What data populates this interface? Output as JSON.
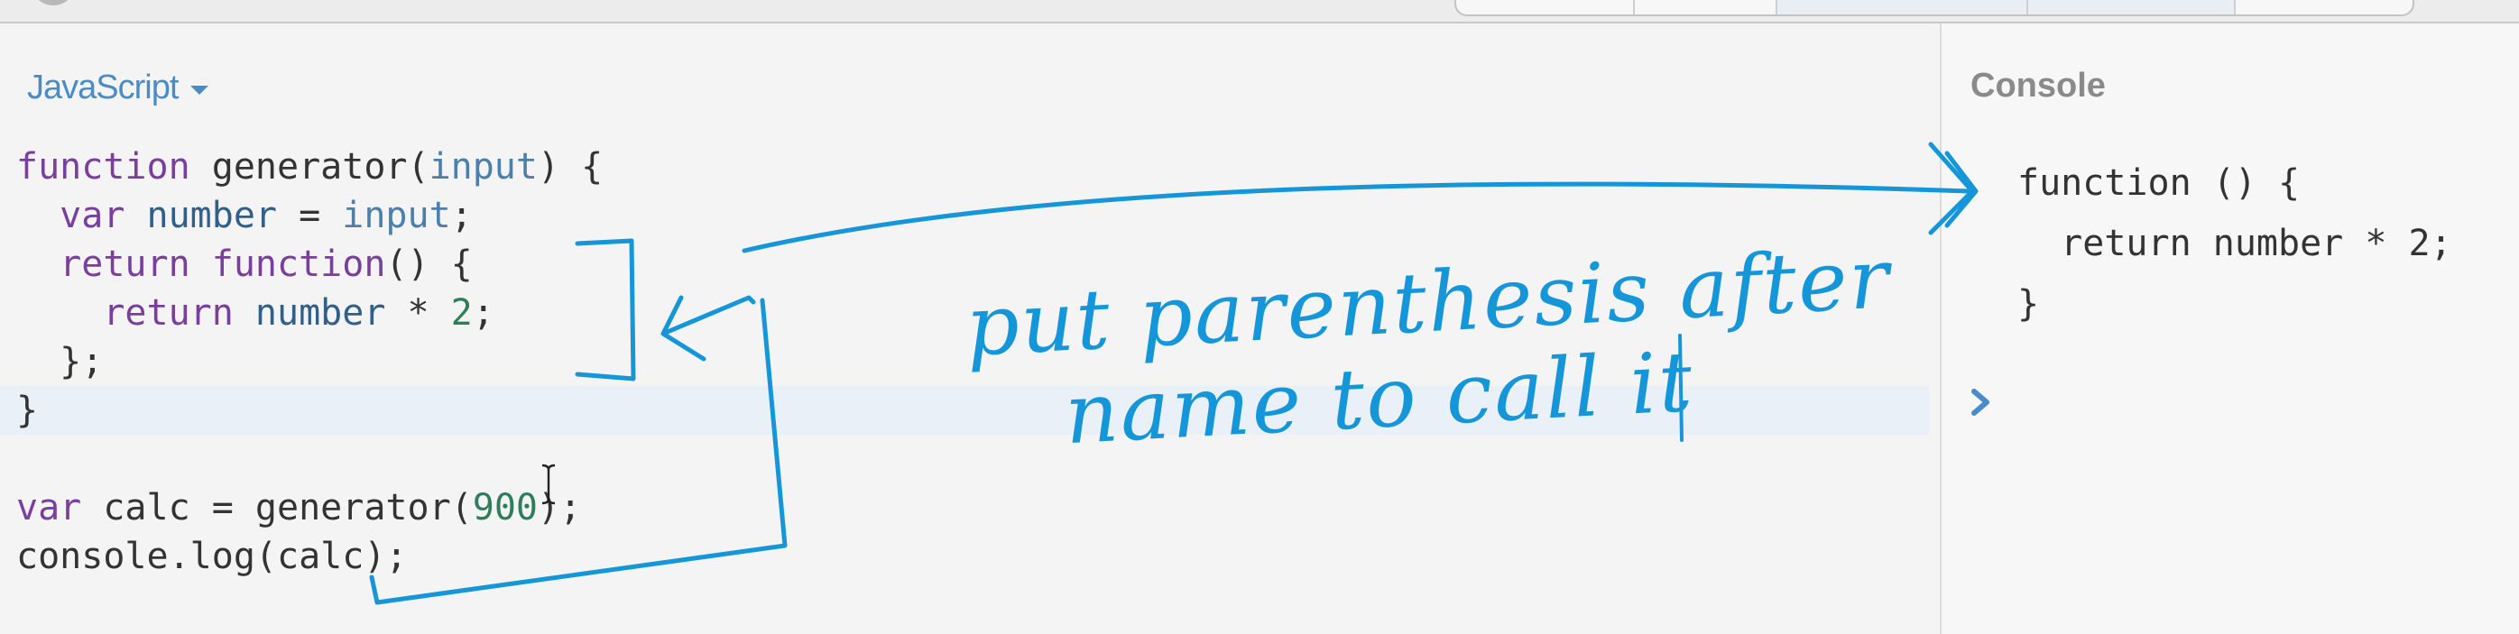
{
  "editor": {
    "language": "JavaScript",
    "code_lines": [
      [
        {
          "t": "function",
          "c": "kw"
        },
        {
          "t": " generator(",
          "c": ""
        },
        {
          "t": "input",
          "c": "pr"
        },
        {
          "t": ") {",
          "c": ""
        }
      ],
      [
        {
          "t": "  ",
          "c": ""
        },
        {
          "t": "var",
          "c": "kw"
        },
        {
          "t": " number ",
          "c": "vr"
        },
        {
          "t": "= ",
          "c": ""
        },
        {
          "t": "input",
          "c": "pr"
        },
        {
          "t": ";",
          "c": ""
        }
      ],
      [
        {
          "t": "  ",
          "c": ""
        },
        {
          "t": "return",
          "c": "kw"
        },
        {
          "t": " ",
          "c": ""
        },
        {
          "t": "function",
          "c": "kw"
        },
        {
          "t": "() {",
          "c": ""
        }
      ],
      [
        {
          "t": "    ",
          "c": ""
        },
        {
          "t": "return",
          "c": "kw"
        },
        {
          "t": " number ",
          "c": "vr"
        },
        {
          "t": "* ",
          "c": ""
        },
        {
          "t": "2",
          "c": "nm"
        },
        {
          "t": ";",
          "c": ""
        }
      ],
      [
        {
          "t": "  };",
          "c": ""
        }
      ],
      [
        {
          "t": "}",
          "c": ""
        }
      ],
      [
        {
          "t": "",
          "c": ""
        }
      ],
      [
        {
          "t": "var",
          "c": "kw"
        },
        {
          "t": " calc = generator(",
          "c": ""
        },
        {
          "t": "900",
          "c": "nm"
        },
        {
          "t": ");",
          "c": ""
        }
      ],
      [
        {
          "t": "console.log(calc);",
          "c": ""
        }
      ]
    ],
    "active_line": 5
  },
  "console": {
    "title": "Console",
    "output": [
      "function () {",
      "  return number * 2;",
      "}"
    ]
  },
  "annotation": {
    "line1": "put parenthesis after",
    "line2": "name to call it"
  },
  "colors": {
    "ink": "#1596d8",
    "accent": "#4a8cc8"
  }
}
